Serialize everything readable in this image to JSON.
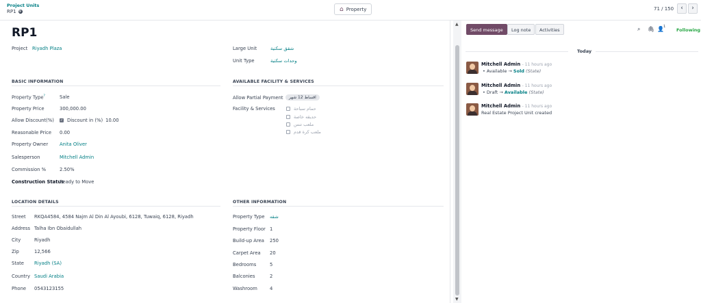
{
  "breadcrumb": {
    "parent": "Project Units",
    "current": "RP1"
  },
  "smart_button": {
    "label": "Property",
    "icon": "home-icon"
  },
  "pager": {
    "text": "71 / 150",
    "prev": "‹",
    "next": "›"
  },
  "record": {
    "title": "RP1"
  },
  "header_fields": {
    "project_label": "Project",
    "project_value": "Riyadh Plaza",
    "large_unit_label": "Large Unit",
    "large_unit_value": "شقق سكنية",
    "unit_type_label": "Unit Type",
    "unit_type_value": "وحدات سكنية"
  },
  "basic_info": {
    "title": "BASIC INFORMATION",
    "property_type_label": "Property Type",
    "property_type_sup": "?",
    "property_type_value": "Sale",
    "price_label": "Property Price",
    "price_value": "300,000.00",
    "discount_label": "Allow Discount(%)",
    "discount_check_label": "Discount in (%)",
    "discount_value": "10.00",
    "reasonable_label": "Reasonable Price",
    "reasonable_value": "0.00",
    "owner_label": "Property Owner",
    "owner_value": "Anita Oliver",
    "sales_label": "Salesperson",
    "sales_value": "Mitchell Admin",
    "commission_label": "Commission %",
    "commission_value": "2.50%",
    "construction_label": "Construction Status",
    "construction_value": "Ready to Move"
  },
  "facility": {
    "title": "AVAILABLE FACILITY & SERVICES",
    "partial_label": "Allow Partial Payment",
    "partial_value": "اقساط 12 شهر",
    "services_label": "Facility & Services",
    "items": [
      "حمام سباحة",
      "حديقه خاصة",
      "ملعب تنس",
      "ملعب كرة قدم"
    ]
  },
  "location": {
    "title": "LOCATION DETAILS",
    "street_label": "Street",
    "street_value": "RKQA4584, 4584 Najm Al Din Al Ayoubi, 6128, Tuwaiq, 6128, Riyadh",
    "address_label": "Address",
    "address_value": "Talha Ibn Obaidullah",
    "city_label": "City",
    "city_value": "Riyadh",
    "zip_label": "Zip",
    "zip_value": "12,566",
    "state_label": "State",
    "state_value": "Riyadh (SA)",
    "country_label": "Country",
    "country_value": "Saudi Arabia",
    "phone_label": "Phone",
    "phone_value": "0543123155"
  },
  "other": {
    "title": "OTHER INFORMATION",
    "ptype_label": "Property Type",
    "ptype_value": "شقه",
    "floor_label": "Property Floor",
    "floor_value": "1",
    "buildup_label": "Build-up Area",
    "buildup_value": "250",
    "carpet_label": "Carpet Area",
    "carpet_value": "20",
    "bedrooms_label": "Bedrooms",
    "bedrooms_value": "5",
    "balconies_label": "Balconies",
    "balconies_value": "2",
    "washroom_label": "Washroom",
    "washroom_value": "4"
  },
  "chatter": {
    "send_message": "Send message",
    "log_note": "Log note",
    "activities": "Activities",
    "follower_count": "1",
    "following": "Following",
    "day_separator": "Today",
    "messages": [
      {
        "author": "Mitchell Admin",
        "time": "- 11 hours ago",
        "old": "Available",
        "new": "Sold",
        "field": "(State)"
      },
      {
        "author": "Mitchell Admin",
        "time": "- 11 hours ago",
        "old": "Draft",
        "new": "Available",
        "field": "(State)"
      },
      {
        "author": "Mitchell Admin",
        "time": "- 11 hours ago",
        "body": "Real Estate Project Unit created"
      }
    ]
  },
  "colors": {
    "accent": "#017e84",
    "primary": "#714b67",
    "following": "#28a745"
  }
}
